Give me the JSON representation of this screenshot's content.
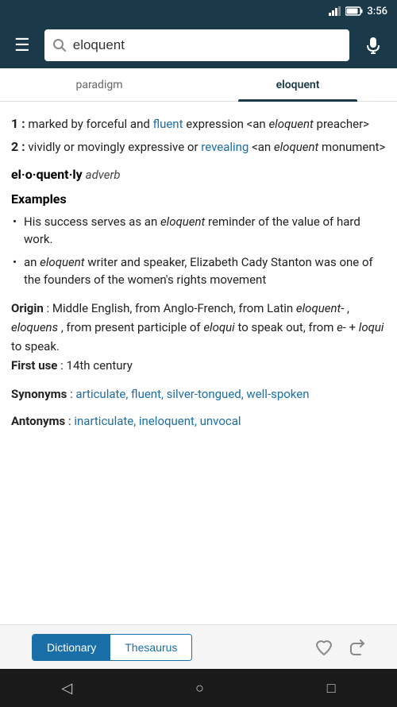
{
  "statusBar": {
    "time": "3:56"
  },
  "topBar": {
    "hamburgerLabel": "☰",
    "searchValue": "eloquent",
    "searchPlaceholder": "Search",
    "micLabel": "mic"
  },
  "tabs": [
    {
      "id": "paradigm",
      "label": "paradigm",
      "active": false
    },
    {
      "id": "eloquent",
      "label": "eloquent",
      "active": true
    }
  ],
  "content": {
    "definition1Prefix": "1 :",
    "definition1Text1": " marked by forceful and ",
    "definition1Link": "fluent",
    "definition1Text2": " expression <an ",
    "definition1Italic": "eloquent",
    "definition1Text3": " preacher>",
    "definition2Prefix": "2 :",
    "definition2Text1": " vividly or movingly expressive or ",
    "definition2Link": "revealing",
    "definition2Text2": " <an ",
    "definition2Italic": "eloquent",
    "definition2Text3": " monument>",
    "adverbWord": "el·o·quent·ly",
    "adverbPos": "adverb",
    "examplesHeading": "Examples",
    "examples": [
      "His success serves as an eloquent reminder of the value of hard work.",
      "an eloquent writer and speaker, Elizabeth Cady Stanton was one of the founders of the women's rights movement"
    ],
    "examplesItalicWord1": "eloquent",
    "examplesItalicWord2": "eloquent",
    "originLabel": "Origin",
    "originText": ": Middle English, from Anglo-French, from Latin ",
    "originItalic1": "eloquent-",
    "originText2": ", ",
    "originItalic2": "eloquens",
    "originText3": ", from present participle of ",
    "originItalic3": "eloqui",
    "originText4": " to speak out, from ",
    "originItalic4": "e-",
    "originText5": " + ",
    "originItalic5": "loqui",
    "originText6": " to speak.",
    "firstUseLabel": "First use",
    "firstUseText": ": 14th century",
    "synonymsLabel": "Synonyms",
    "synonymsLinks": "articulate, fluent, silver-tongued, well-spoken",
    "antonymsLabel": "Antonyms",
    "antonymsLinks": "inarticulate, ineloquent, unvocal"
  },
  "bottomBar": {
    "dictionaryLabel": "Dictionary",
    "thesaurusLabel": "Thesaurus",
    "activeTab": "dictionary"
  },
  "navBar": {
    "back": "◁",
    "home": "○",
    "recent": "□"
  }
}
